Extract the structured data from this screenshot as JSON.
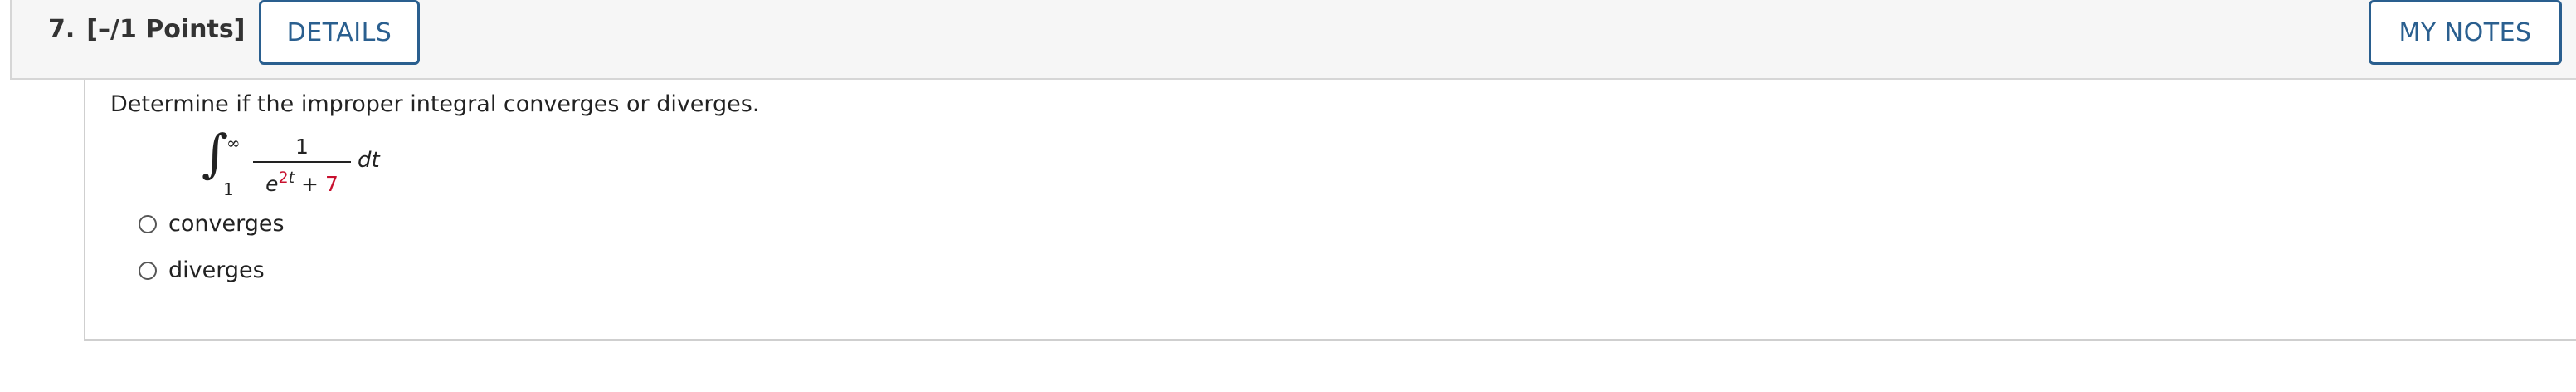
{
  "question": {
    "number": "7.",
    "points": "[–/1 Points]",
    "details_label": "DETAILS",
    "notes_label": "MY NOTES"
  },
  "problem": {
    "prompt": "Determine if the improper integral converges or diverges.",
    "integral": {
      "upper_limit": "∞",
      "lower_limit": "1",
      "numerator": "1",
      "denominator_base": "e",
      "exponent_coefficient": "2",
      "exponent_variable": "t",
      "plus": "+",
      "constant": "7",
      "differential": "dt"
    },
    "options": [
      {
        "label": "converges",
        "selected": false
      },
      {
        "label": "diverges",
        "selected": false
      }
    ]
  },
  "colors": {
    "accent": "#2a5f8f",
    "highlight": "#c8102e",
    "header_bg": "#f6f6f6"
  }
}
